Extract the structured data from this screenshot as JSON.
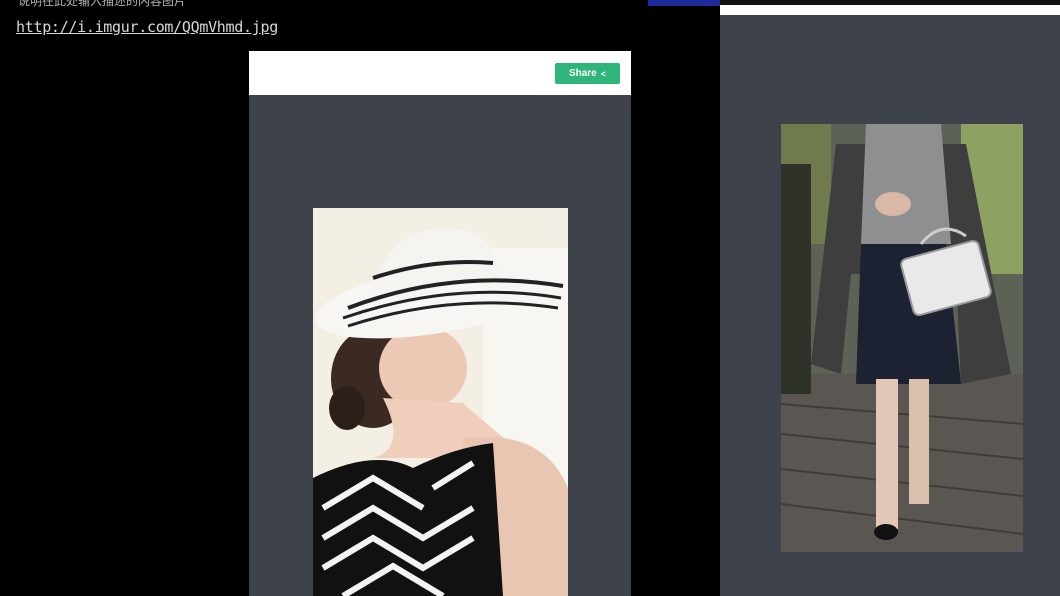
{
  "page": {
    "top_snippet": "说明在此处输入描述的内容图片",
    "image_url": "http://i.imgur.com/QQmVhmd.jpg"
  },
  "left_viewer": {
    "share_label": "Share",
    "share_icon": "share-icon"
  },
  "right_viewer": {},
  "colors": {
    "background": "#000000",
    "viewer_bg": "#3e434b",
    "share_green": "#2fb57a",
    "toolbar": "#ffffff"
  }
}
